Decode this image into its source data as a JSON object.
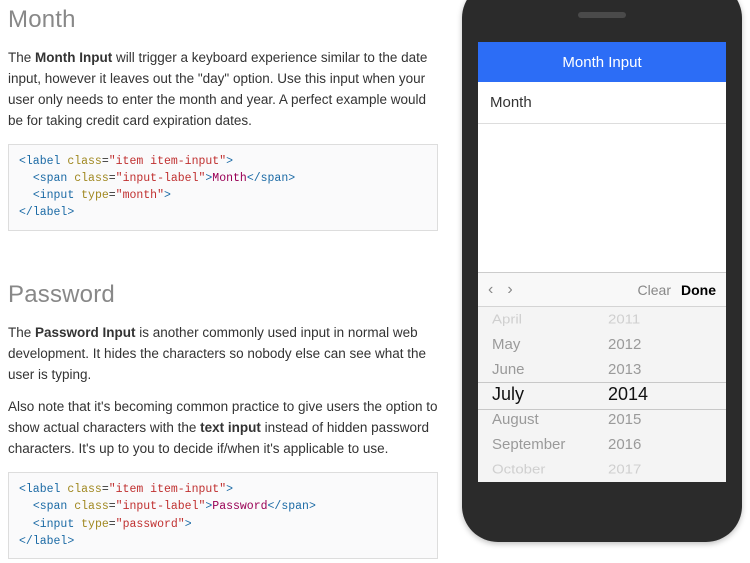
{
  "sections": {
    "month": {
      "heading": "Month",
      "para1_pre": "The ",
      "para1_bold": "Month Input",
      "para1_post": " will trigger a keyboard experience similar to the date input, however it leaves out the \"day\" option. Use this input when your user only needs to enter the month and year. A perfect example would be for taking credit card expiration dates.",
      "code": {
        "label_cls": "item item-input",
        "span_cls": "input-label",
        "span_text": "Month",
        "input_type": "month"
      }
    },
    "password": {
      "heading": "Password",
      "para1_pre": "The ",
      "para1_bold": "Password Input",
      "para1_post": " is another commonly used input in normal web development. It hides the characters so nobody else can see what the user is typing.",
      "para2_pre": "Also note that it's becoming common practice to give users the option to show actual characters with the ",
      "para2_bold": "text input",
      "para2_post": " instead of hidden password characters. It's up to you to decide if/when it's applicable to use.",
      "code": {
        "label_cls": "item item-input",
        "span_cls": "input-label",
        "span_text": "Password",
        "input_type": "password"
      }
    }
  },
  "phone": {
    "header_title": "Month Input",
    "field_label": "Month",
    "toolbar": {
      "prev_glyph": "‹",
      "next_glyph": "›",
      "clear_label": "Clear",
      "done_label": "Done"
    },
    "picker": {
      "months": [
        "April",
        "May",
        "June",
        "July",
        "August",
        "September",
        "October"
      ],
      "years": [
        "2011",
        "2012",
        "2013",
        "2014",
        "2015",
        "2016",
        "2017"
      ],
      "selected_index": 3
    }
  },
  "tok": {
    "lt": "<",
    "gt": ">",
    "lts": "</",
    "label": "label",
    "span": "span",
    "input": "input",
    "class": "class",
    "type": "type",
    "eq": "=",
    "q": "\""
  }
}
